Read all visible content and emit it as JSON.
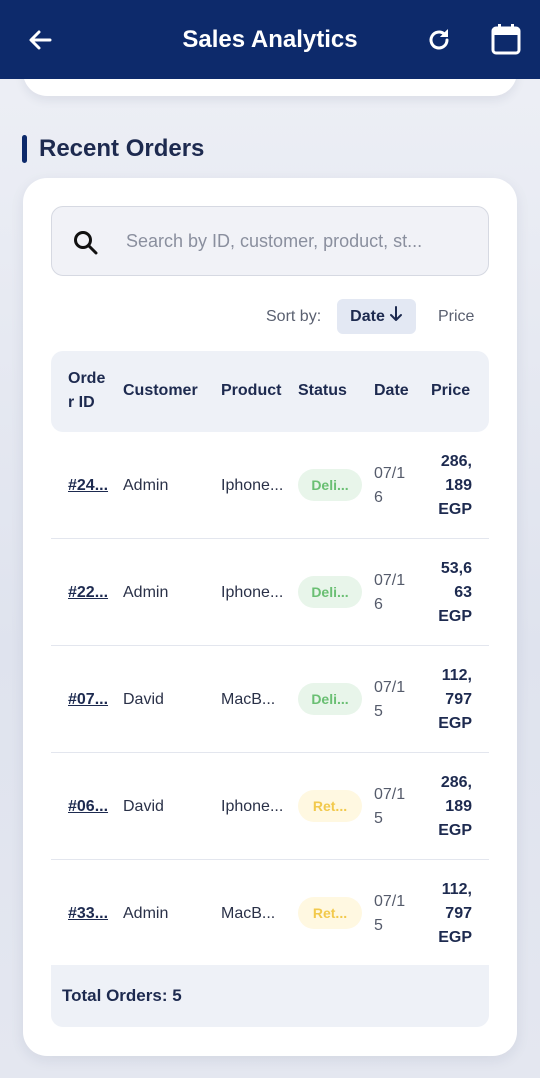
{
  "appbar": {
    "title": "Sales Analytics",
    "icons": {
      "back": "arrow-left-icon",
      "refresh": "refresh-icon",
      "calendar": "calendar-icon"
    }
  },
  "section": {
    "title": "Recent Orders"
  },
  "search": {
    "placeholder": "Search by ID, customer, product, st..."
  },
  "sort": {
    "label": "Sort by:",
    "date": "Date",
    "date_direction": "descending",
    "price": "Price"
  },
  "table": {
    "headers": {
      "order_id": "Orde r ID",
      "customer": "Customer",
      "product": "Product",
      "status": "Status",
      "date": "Date",
      "price": "Price"
    },
    "rows": [
      {
        "id": "#24...",
        "customer": "Admin",
        "product": "Iphone...",
        "status": "Deli...",
        "status_type": "delivered",
        "date": "07/1 6",
        "price": "286, 189 EGP"
      },
      {
        "id": "#22...",
        "customer": "Admin",
        "product": "Iphone...",
        "status": "Deli...",
        "status_type": "delivered",
        "date": "07/1 6",
        "price": "53,6 63 EGP"
      },
      {
        "id": "#07...",
        "customer": "David",
        "product": "MacB...",
        "status": "Deli...",
        "status_type": "delivered",
        "date": "07/1 5",
        "price": "112, 797 EGP"
      },
      {
        "id": "#06...",
        "customer": "David",
        "product": "Iphone...",
        "status": "Ret...",
        "status_type": "returned",
        "date": "07/1 5",
        "price": "286, 189 EGP"
      },
      {
        "id": "#33...",
        "customer": "Admin",
        "product": "MacB...",
        "status": "Ret...",
        "status_type": "returned",
        "date": "07/1 5",
        "price": "112, 797 EGP"
      }
    ]
  },
  "footer": {
    "total": "Total Orders: 5"
  },
  "colors": {
    "appbar": "#0d2a6b",
    "delivered": "#6abf73",
    "returned": "#f2c94c"
  }
}
